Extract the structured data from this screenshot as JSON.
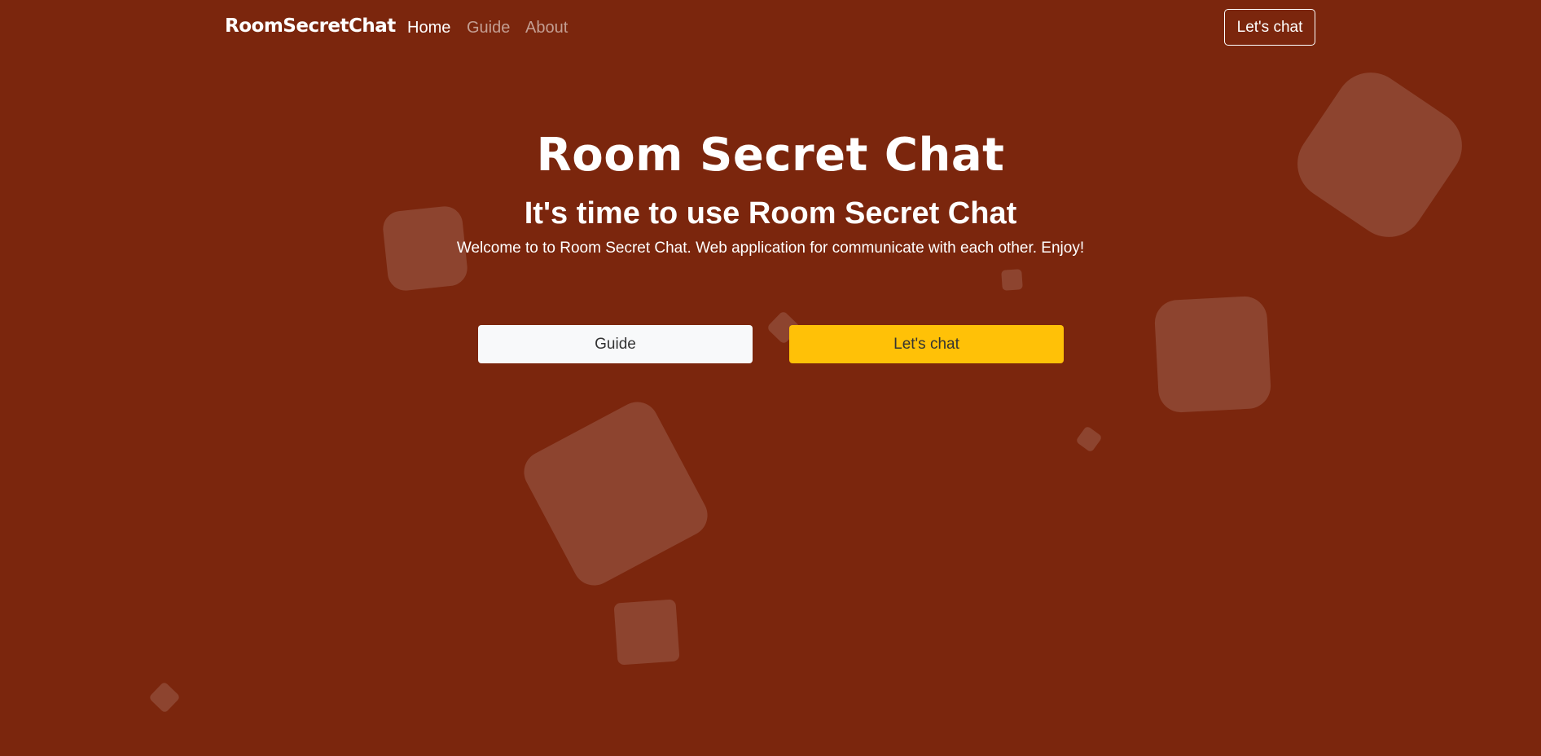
{
  "colors": {
    "background": "#7b260d",
    "accent": "#ffc107",
    "light_button": "#f8f9fa"
  },
  "navbar": {
    "brand": "RoomSecretChat",
    "links": [
      "Home",
      "Guide",
      "About"
    ],
    "active_link": "Home",
    "cta_label": "Let's chat"
  },
  "hero": {
    "title": "Room Secret Chat",
    "subtitle": "It's time to use Room Secret Chat",
    "description": "Welcome to to Room Secret Chat. Web application for communicate with each other. Enjoy!",
    "buttons": {
      "guide_label": "Guide",
      "chat_label": "Let's chat"
    }
  }
}
